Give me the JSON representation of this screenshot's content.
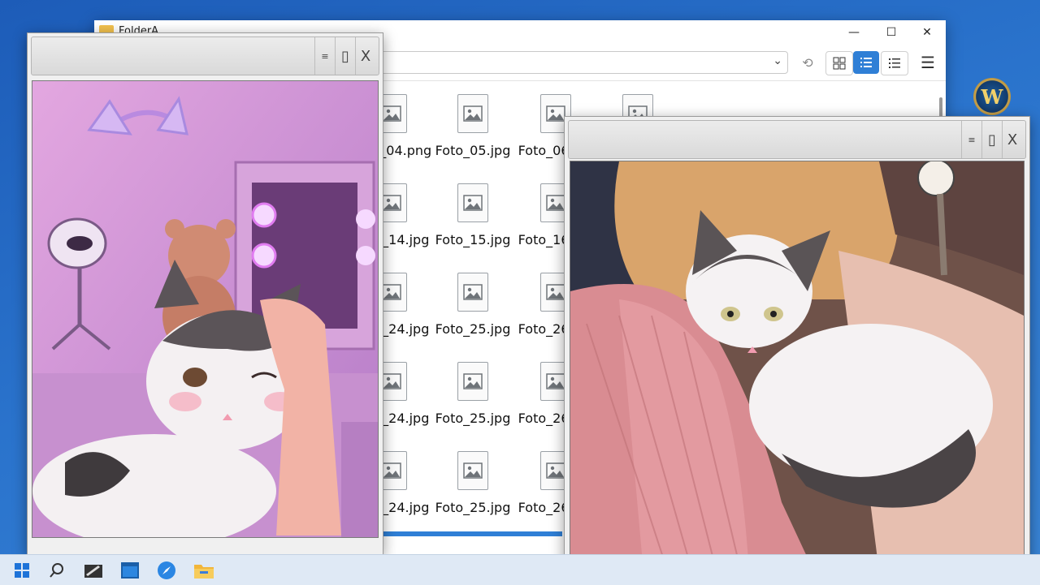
{
  "explorer": {
    "title": "FolderA",
    "caption": {
      "minimize": "—",
      "maximize": "☐",
      "close": "✕"
    },
    "toolbar": {
      "address_value": "",
      "address_chevron": "⌄",
      "refresh_glyph": "⟲",
      "view_buttons": [
        "grid-view-icon",
        "details-view-icon",
        "list-view-icon"
      ],
      "menu_glyph": "☰"
    },
    "files": [
      [
        "Foto_04.png",
        "Foto_05.jpg",
        "Foto_06.jpg"
      ],
      [
        "Foto_14.jpg",
        "Foto_15.jpg",
        "Foto_16.jpg"
      ],
      [
        "Foto_24.jpg",
        "Foto_25.jpg",
        "Foto_26.jpg"
      ],
      [
        "Foto_24.jpg",
        "Foto_25.jpg",
        "Foto_26.jpg"
      ],
      [
        "Foto_24.jpg",
        "Foto_25.jpg",
        "Foto_26.jpg"
      ]
    ]
  },
  "viewer_left": {
    "buttons": [
      "≡",
      "▯",
      "X"
    ],
    "image": "cat-winking-pink-room"
  },
  "viewer_right": {
    "buttons": [
      "≡",
      "▯",
      "X"
    ],
    "image": "cat-lying-on-pink-blanket"
  },
  "desktop": {
    "wow_icon_letter": "W"
  },
  "taskbar": {
    "items": [
      "windows-start-icon",
      "search-icon",
      "pen-tablet-icon",
      "window-app-icon",
      "browser-compass-icon",
      "file-explorer-icon"
    ]
  },
  "colors": {
    "accent": "#2f7fd6",
    "desktop": "#2a73cc",
    "viewer_pink": "#c98bd0"
  }
}
